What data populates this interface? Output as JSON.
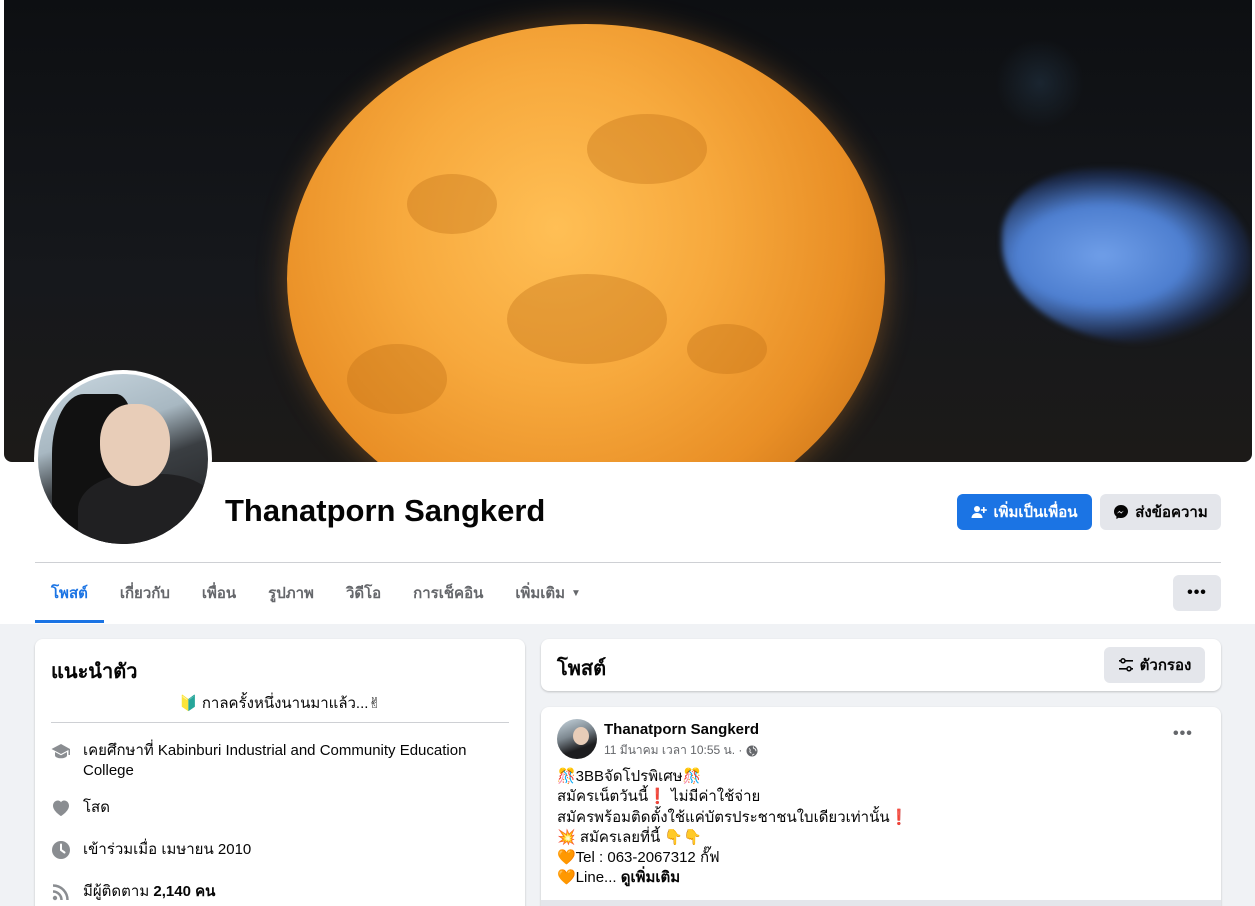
{
  "profile": {
    "name": "Thanatporn Sangkerd",
    "add_friend_label": "เพิ่มเป็นเพื่อน",
    "message_label": "ส่งข้อความ"
  },
  "tabs": [
    {
      "label": "โพสต์",
      "active": true
    },
    {
      "label": "เกี่ยวกับ"
    },
    {
      "label": "เพื่อน"
    },
    {
      "label": "รูปภาพ"
    },
    {
      "label": "วิดีโอ"
    },
    {
      "label": "การเช็คอิน"
    },
    {
      "label": "เพิ่มเติม"
    }
  ],
  "more_button_label": "•••",
  "intro": {
    "title": "แนะนำตัว",
    "bio": "🔰 กาลครั้งหนึ่งนานมาแล้ว...✌",
    "education": "เคยศึกษาที่ Kabinburi Industrial and Community Education College",
    "relationship": "โสด",
    "joined": "เข้าร่วมเมื่อ เมษายน 2010",
    "followers_prefix": "มีผู้ติดตาม",
    "followers_count": "2,140 คน"
  },
  "posts_header": {
    "title": "โพสต์",
    "filter_label": "ตัวกรอง"
  },
  "post": {
    "author": "Thanatporn Sangkerd",
    "timestamp": "11 มีนาคม เวลา 10:55 น. ·",
    "more_label": "•••",
    "lines": [
      "🎊3BBจัดโปรพิเศษ🎊",
      "สมัครเน็ตวันนี้❗ ไม่มีค่าใช้จ่าย",
      "สมัครพร้อมติดตั้งใช้แค่บัตรประชาชนใบเดียวเท่านั้น❗",
      "💥 สมัครเลยที่นี้ 👇👇",
      "🧡Tel : 063-2067312 กั๊ฟ",
      "🧡Line..."
    ],
    "see_more": "ดูเพิ่มเติม"
  },
  "colors": {
    "accent": "#1b74e4",
    "secondary_button": "#e4e6eb",
    "background": "#f0f2f5"
  }
}
